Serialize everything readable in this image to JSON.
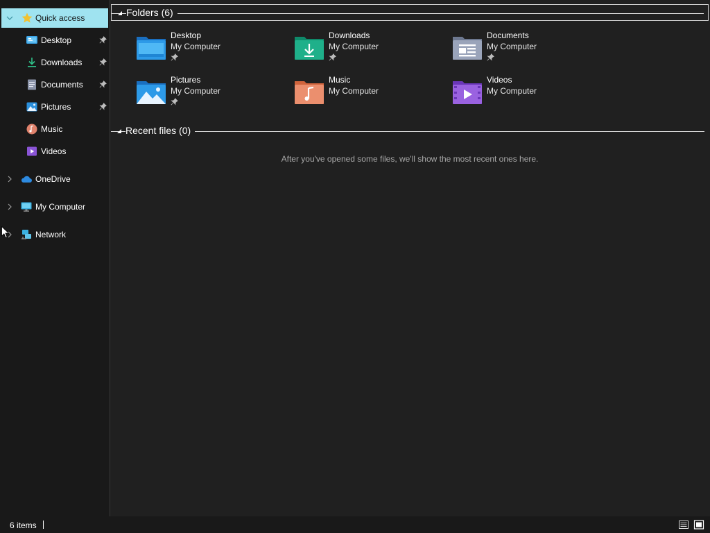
{
  "sidebar": {
    "items": [
      {
        "label": "Quick access",
        "icon": "star-icon"
      },
      {
        "label": "Desktop",
        "icon": "desktop-icon",
        "pinned": true
      },
      {
        "label": "Downloads",
        "icon": "download-icon",
        "pinned": true
      },
      {
        "label": "Documents",
        "icon": "document-icon",
        "pinned": true
      },
      {
        "label": "Pictures",
        "icon": "picture-icon",
        "pinned": true
      },
      {
        "label": "Music",
        "icon": "music-icon"
      },
      {
        "label": "Videos",
        "icon": "video-icon"
      },
      {
        "label": "OneDrive",
        "icon": "cloud-icon"
      },
      {
        "label": "My Computer",
        "icon": "computer-icon"
      },
      {
        "label": "Network",
        "icon": "network-icon"
      }
    ]
  },
  "content": {
    "folders_header": "Folders (6)",
    "recent_header": "Recent files (0)",
    "recent_empty": "After you've opened some files, we'll show the most recent ones here.",
    "folders": [
      {
        "name": "Desktop",
        "location": "My Computer",
        "pinned": true,
        "icon": "desktop-folder-icon"
      },
      {
        "name": "Downloads",
        "location": "My Computer",
        "pinned": true,
        "icon": "downloads-folder-icon"
      },
      {
        "name": "Documents",
        "location": "My Computer",
        "pinned": true,
        "icon": "documents-folder-icon"
      },
      {
        "name": "Pictures",
        "location": "My Computer",
        "pinned": true,
        "icon": "pictures-folder-icon"
      },
      {
        "name": "Music",
        "location": "My Computer",
        "pinned": false,
        "icon": "music-folder-icon"
      },
      {
        "name": "Videos",
        "location": "My Computer",
        "pinned": false,
        "icon": "videos-folder-icon"
      }
    ]
  },
  "status": {
    "item_count": "6 items"
  },
  "colors": {
    "background": "#202020",
    "sidebar_background": "#191919",
    "selection": "#9fe3f0"
  }
}
